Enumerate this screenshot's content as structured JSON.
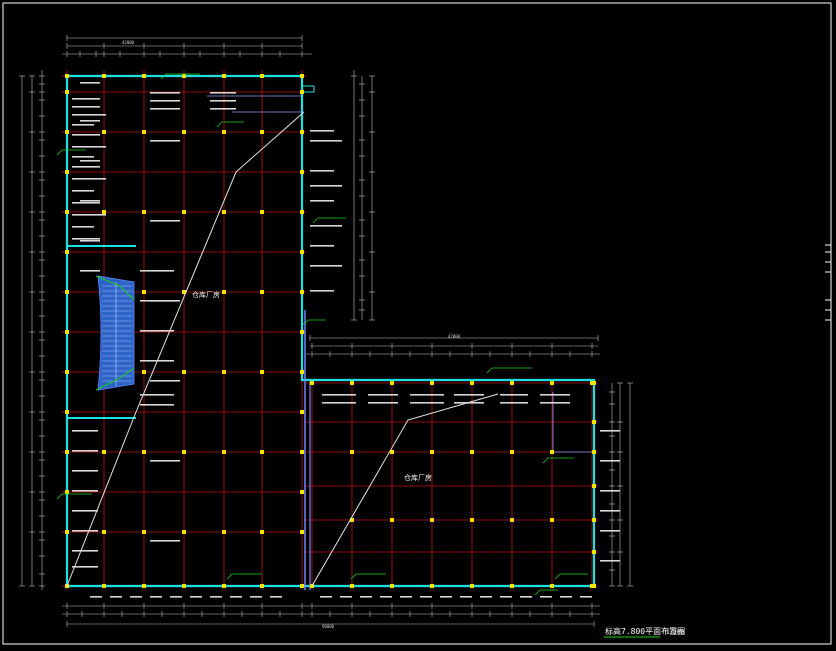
{
  "drawing": {
    "title": "标高7.800平面布置图",
    "scale": "1:200",
    "room_labels": [
      "仓库厂房",
      "仓库厂房"
    ],
    "top_total_dim": "42000",
    "lower_top_total_dim": "42000",
    "bottom_total_dim": "90000"
  },
  "colors": {
    "background": "#000000",
    "frame": "#ffffff",
    "grid": "#c01010",
    "wall": "#1ee0e0",
    "column": "#f2e600",
    "dim": "#c0c0c0",
    "annotation": "#18d018",
    "route": "#e6e6e6",
    "stair": "#2e63c8"
  }
}
